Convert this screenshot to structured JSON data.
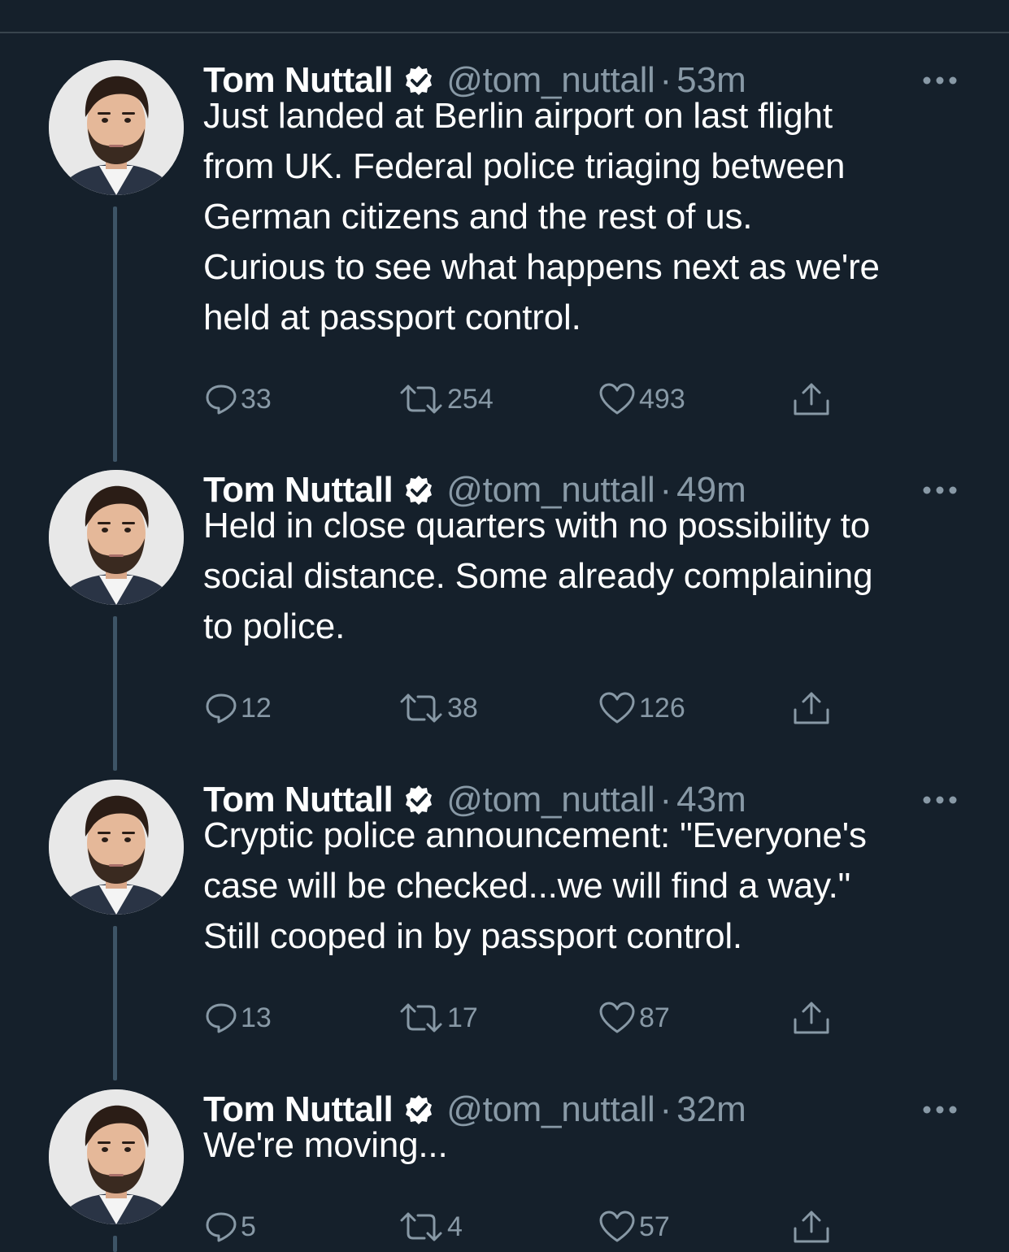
{
  "tweets": [
    {
      "name": "Tom Nuttall",
      "handle": "@tom_nuttall",
      "separator": "·",
      "time": "53m",
      "text": "Just landed at Berlin airport on last flight\nfrom UK. Federal police triaging between\nGerman citizens and the rest of us.\nCurious to see what happens next as we're\nheld at passport control.",
      "replies": "33",
      "retweets": "254",
      "likes": "493"
    },
    {
      "name": "Tom Nuttall",
      "handle": "@tom_nuttall",
      "separator": "·",
      "time": "49m",
      "text": "Held in close quarters with no possibility to\nsocial distance. Some already complaining\nto police.",
      "replies": "12",
      "retweets": "38",
      "likes": "126"
    },
    {
      "name": "Tom Nuttall",
      "handle": "@tom_nuttall",
      "separator": "·",
      "time": "43m",
      "text": "Cryptic police announcement: \"Everyone's\ncase will be checked...we will find a way.\"\nStill cooped in by passport control.",
      "replies": "13",
      "retweets": "17",
      "likes": "87"
    },
    {
      "name": "Tom Nuttall",
      "handle": "@tom_nuttall",
      "separator": "·",
      "time": "32m",
      "text": "We're moving...",
      "replies": "5",
      "retweets": "4",
      "likes": "57"
    }
  ],
  "icons": {
    "verified": "verified-badge-icon",
    "more": "more-options-icon",
    "reply": "reply-icon",
    "retweet": "retweet-icon",
    "like": "like-icon",
    "share": "share-icon"
  },
  "colors": {
    "background": "#15202b",
    "primary_text": "#ffffff",
    "secondary_text": "#8899a6",
    "thread_line": "#3d5466",
    "divider": "#38444d"
  }
}
